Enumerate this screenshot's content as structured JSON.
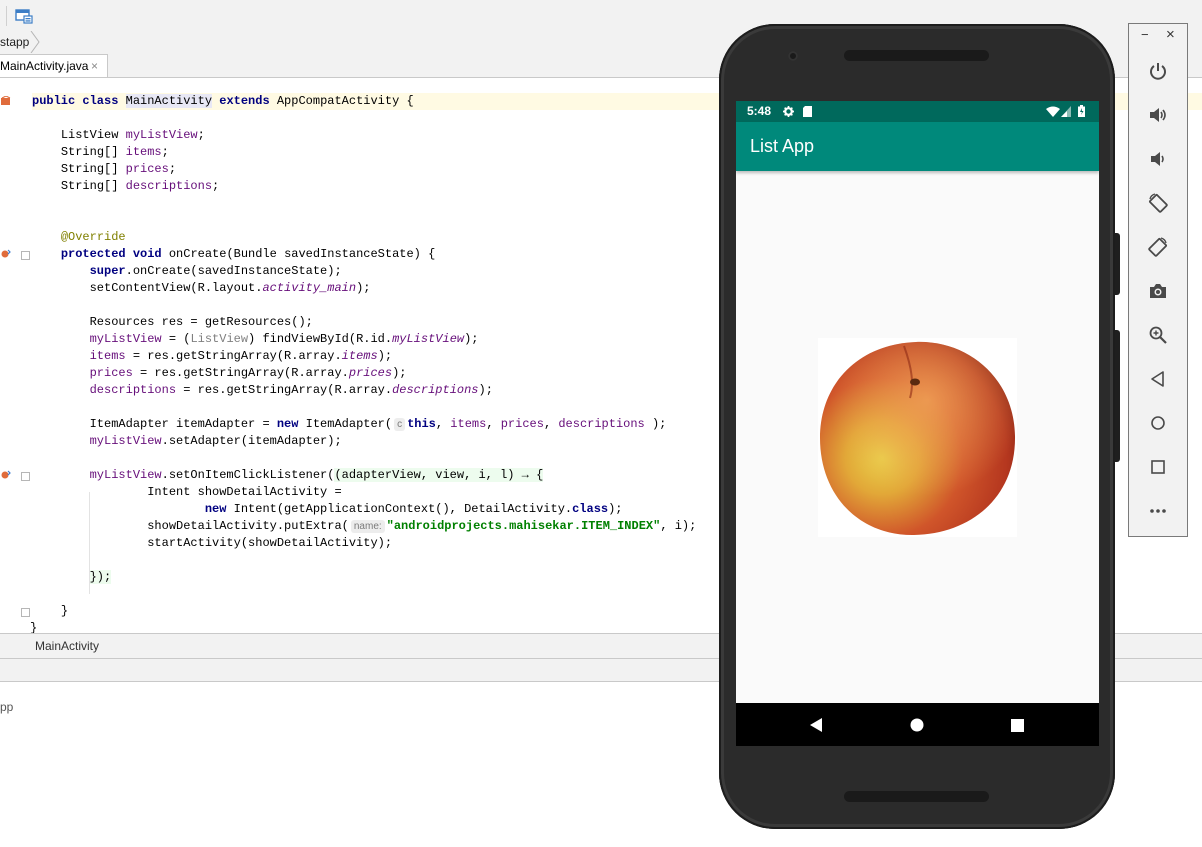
{
  "ide": {
    "breadcrumb": "stapp",
    "tab_label": "MainActivity.java",
    "tab_close": "×",
    "structure_label": "MainActivity",
    "bottom_panel_text": "pp"
  },
  "code": {
    "l1": {
      "kw1": "public class ",
      "cls": "MainActivity",
      "kw2": " extends ",
      "rest": "AppCompatActivity {"
    },
    "l3": {
      "type": "ListView ",
      "fld": "myListView",
      "end": ";"
    },
    "l4": {
      "type": "String[] ",
      "fld": "items",
      "end": ";"
    },
    "l5": {
      "type": "String[] ",
      "fld": "prices",
      "end": ";"
    },
    "l6": {
      "type": "String[] ",
      "fld": "descriptions",
      "end": ";"
    },
    "l9": {
      "ann": "@Override"
    },
    "l10": {
      "kw": "protected void ",
      "rest": "onCreate(Bundle savedInstanceState) {"
    },
    "l11": {
      "kw": "super",
      "rest": ".onCreate(savedInstanceState);"
    },
    "l12": {
      "a": "setContentView(R.layout.",
      "fld": "activity_main",
      "b": ");"
    },
    "l14": {
      "a": "Resources res = getResources();"
    },
    "l15": {
      "fld": "myListView",
      "a": " = (",
      "cast": "ListView",
      "b": ") findViewById(R.id.",
      "fld2": "myListView",
      "c": ");"
    },
    "l16": {
      "fld": "items",
      "a": " = res.getStringArray(R.array.",
      "fld2": "items",
      "b": ");"
    },
    "l17": {
      "fld": "prices",
      "a": " = res.getStringArray(R.array.",
      "fld2": "prices",
      "b": ");"
    },
    "l18": {
      "fld": "descriptions",
      "a": " = res.getStringArray(R.array.",
      "fld2": "descriptions",
      "b": ");"
    },
    "l20": {
      "a": "ItemAdapter itemAdapter = ",
      "kw": "new",
      "b": " ItemAdapter(",
      "hint": "c",
      "kw2": "this",
      "c": ", ",
      "f1": "items",
      "d": ", ",
      "f2": "prices",
      "e": ", ",
      "f3": "descriptions",
      "f": " );"
    },
    "l21": {
      "fld": "myListView",
      "a": ".setAdapter(itemAdapter);"
    },
    "l23": {
      "fld": "myListView",
      "a": ".setOnItemClickListener(",
      "lam": "(adapterView, view, i, l) → {"
    },
    "l24": {
      "a": "Intent showDetailActivity ="
    },
    "l25": {
      "kw": "new",
      "a": " Intent(getApplicationContext(), DetailActivity.",
      "kw2": "class",
      "b": ");"
    },
    "l26": {
      "a": "showDetailActivity.putExtra(",
      "hint": "name:",
      "str": "\"androidprojects.mahisekar.ITEM_INDEX\"",
      "b": ", i);"
    },
    "l27": {
      "a": "startActivity(showDetailActivity);"
    },
    "l29": {
      "lam": "});"
    },
    "l31": {
      "a": "}"
    },
    "l32": {
      "a": "}"
    }
  },
  "phone": {
    "time": "5:48",
    "app_title": "List App"
  },
  "emulator": {
    "minimize": "−",
    "close": "×"
  },
  "colors": {
    "status_bar": "#00695c",
    "app_bar": "#00897b",
    "keyword": "#000080",
    "field": "#660e7a",
    "annotation": "#808000",
    "string": "#008000"
  }
}
